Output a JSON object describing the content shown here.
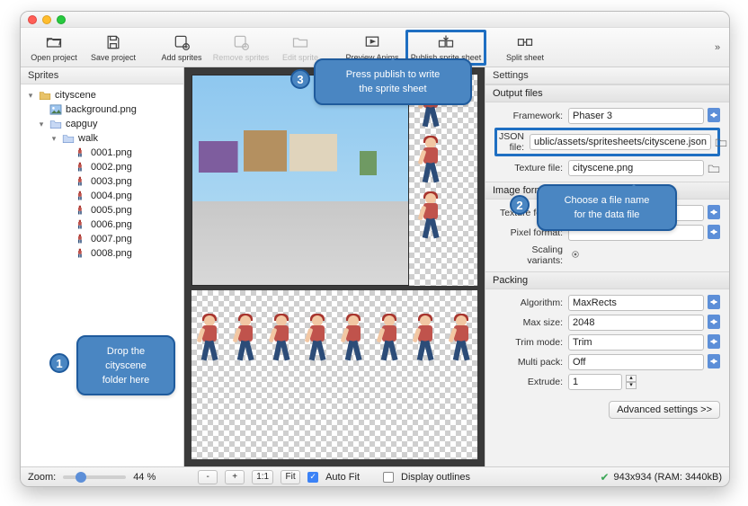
{
  "toolbar": {
    "open": "Open project",
    "save": "Save project",
    "add": "Add sprites",
    "remove": "Remove sprites",
    "edit": "Edit sprite",
    "preview": "Preview Anims",
    "publish": "Publish sprite sheet",
    "split": "Split sheet"
  },
  "sidebar": {
    "title": "Sprites",
    "root": "cityscene",
    "bg": "background.png",
    "capguy": "capguy",
    "walk": "walk",
    "frames": [
      "0001.png",
      "0002.png",
      "0003.png",
      "0004.png",
      "0005.png",
      "0006.png",
      "0007.png",
      "0008.png"
    ]
  },
  "settings": {
    "title": "Settings",
    "output_section": "Output files",
    "framework_k": "Framework:",
    "framework_v": "Phaser 3",
    "json_k": "JSON file:",
    "json_v": "ublic/assets/spritesheets/cityscene.json",
    "tex_k": "Texture file:",
    "tex_v": "cityscene.png",
    "imgfmt_section": "Image format",
    "texfmt_k": "Texture format:",
    "pixfmt_k": "Pixel format:",
    "scaling_k": "Scaling variants:",
    "packing_section": "Packing",
    "algo_k": "Algorithm:",
    "algo_v": "MaxRects",
    "max_k": "Max size:",
    "max_v": "2048",
    "trim_k": "Trim mode:",
    "trim_v": "Trim",
    "multi_k": "Multi pack:",
    "multi_v": "Off",
    "extrude_k": "Extrude:",
    "extrude_v": "1",
    "advanced": "Advanced settings >>"
  },
  "status": {
    "zoom_label": "Zoom:",
    "zoom_pct": "44 %",
    "minus": "-",
    "plus": "+",
    "one": "1:1",
    "fit": "Fit",
    "autofit": "Auto Fit",
    "outlines": "Display outlines",
    "dims": "943x934 (RAM: 3440kB)"
  },
  "callouts": {
    "n1": "1",
    "c1": "Drop the\ncityscene\nfolder here",
    "n2": "2",
    "c2": "Choose a file name\nfor the data file",
    "n3": "3",
    "c3": "Press publish to write\nthe sprite sheet"
  }
}
